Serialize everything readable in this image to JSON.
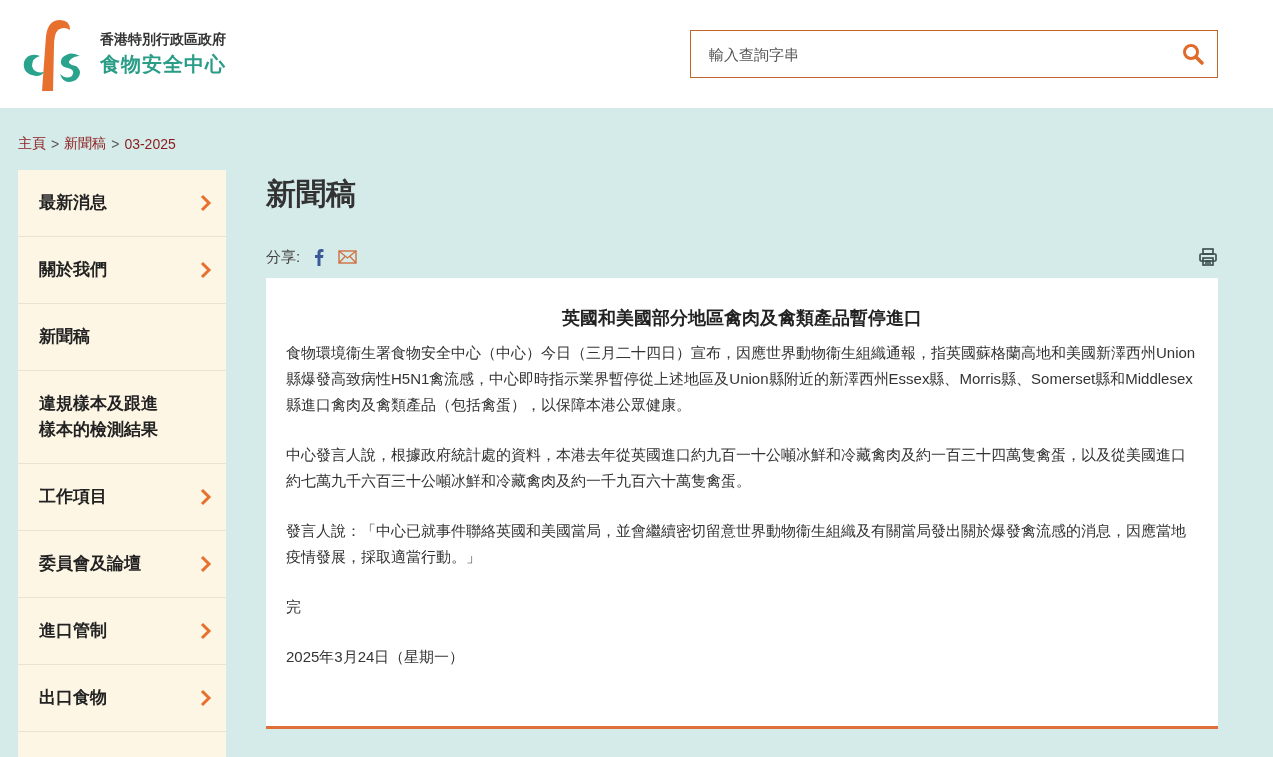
{
  "header": {
    "org_line_1": "香港特別行政區政府",
    "org_line_2": "食物安全中心",
    "search": {
      "placeholder": "輸入查詢字串"
    }
  },
  "breadcrumb": {
    "separator": ">",
    "items": [
      "主頁",
      "新聞稿",
      "03-2025"
    ]
  },
  "sidebar": {
    "items": [
      {
        "label": "最新消息",
        "has_submenu": true
      },
      {
        "label": "關於我們",
        "has_submenu": true
      },
      {
        "label": "新聞稿",
        "has_submenu": false
      },
      {
        "label": "違規樣本及跟進樣本的檢測結果",
        "has_submenu": false
      },
      {
        "label": "工作項目",
        "has_submenu": true
      },
      {
        "label": "委員會及論壇",
        "has_submenu": true
      },
      {
        "label": "進口管制",
        "has_submenu": true
      },
      {
        "label": "出口食物",
        "has_submenu": true
      }
    ]
  },
  "main": {
    "title": "新聞稿",
    "share_label": "分享:",
    "article": {
      "headline": "英國和美國部分地區禽肉及禽類產品暫停進口",
      "paragraphs": [
        "食物環境衞生署食物安全中心（中心）今日（三月二十四日）宣布，因應世界動物衞生組織通報，指英國蘇格蘭高地和美國新澤西州Union縣爆發高致病性H5N1禽流感，中心即時指示業界暫停從上述地區及Union縣附近的新澤西州Essex縣、Morris縣、Somerset縣和Middlesex縣進口禽肉及禽類產品（包括禽蛋），以保障本港公眾健康。",
        "中心發言人說，根據政府統計處的資料，本港去年從英國進口約九百一十公噸冰鮮和冷藏禽肉及約一百三十四萬隻禽蛋，以及從美國進口約七萬九千六百三十公噸冰鮮和冷藏禽肉及約一千九百六十萬隻禽蛋。",
        "發言人說：「中心已就事件聯絡英國和美國當局，並會繼續密切留意世界動物衞生組織及有關當局發出關於爆發禽流感的消息，因應當地疫情發展，採取適當行動。」",
        "完",
        "2025年3月24日（星期一）"
      ]
    }
  }
}
